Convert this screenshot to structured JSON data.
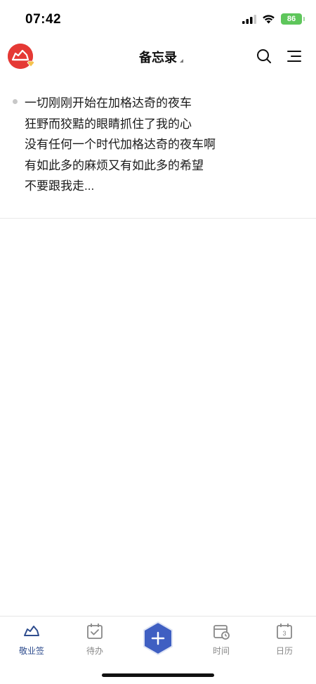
{
  "status": {
    "time": "07:42",
    "battery": "86"
  },
  "header": {
    "title": "备忘录"
  },
  "memos": [
    {
      "lines": [
        "一切刚刚开始在加格达奇的夜车",
        "狂野而狡黠的眼睛抓住了我的心",
        "没有任何一个时代加格达奇的夜车啊",
        "有如此多的麻烦又有如此多的希望",
        "不要跟我走..."
      ]
    }
  ],
  "tabs": [
    {
      "label": "敬业签",
      "icon": "sign-icon",
      "active": true
    },
    {
      "label": "待办",
      "icon": "todo-icon",
      "active": false
    },
    {
      "label": "",
      "icon": "add-icon",
      "active": false
    },
    {
      "label": "时间",
      "icon": "time-icon",
      "active": false
    },
    {
      "label": "日历",
      "icon": "calendar-icon",
      "active": false
    }
  ],
  "calendar_day": "3",
  "colors": {
    "accent": "#3f5fc2",
    "active_tab": "#2f4d8e",
    "avatar_bg": "#e53935",
    "battery": "#5ec65b"
  }
}
